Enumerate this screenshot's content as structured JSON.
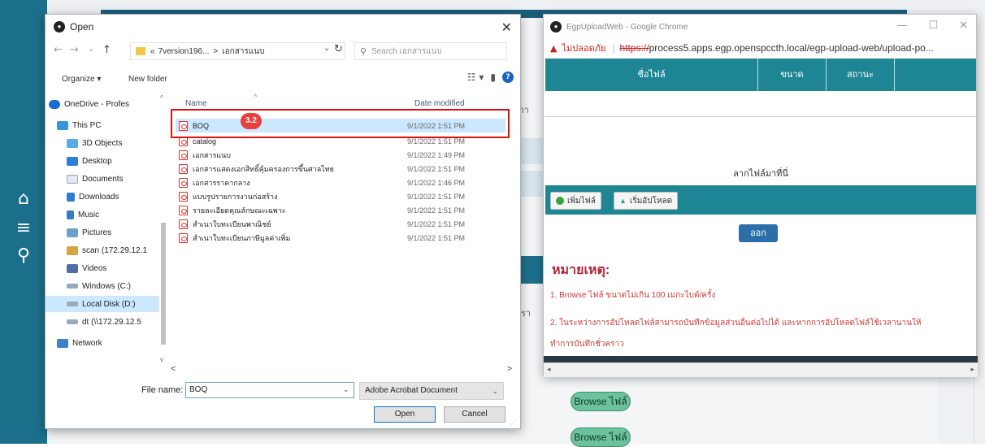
{
  "background": {
    "browse_buttons": [
      "Browse ไฟล์",
      "Browse ไฟล์"
    ],
    "partial_texts": [
      "กา",
      "ปรา"
    ]
  },
  "dialog": {
    "title": "Open",
    "address": {
      "path_part1": "7version196...",
      "separator": ">",
      "path_part2": "เอกสารแนบ"
    },
    "search_placeholder": "Search เอกสารแนบ",
    "toolbar": {
      "organize": "Organize ▾",
      "new_folder": "New folder"
    },
    "nav_items": [
      {
        "label": "OneDrive - Profes",
        "icon": "onedrive-icon"
      },
      {
        "label": "This PC",
        "icon": "pc-icon"
      },
      {
        "label": "3D Objects",
        "icon": "3d-objects-icon"
      },
      {
        "label": "Desktop",
        "icon": "desktop-icon"
      },
      {
        "label": "Documents",
        "icon": "documents-icon"
      },
      {
        "label": "Downloads",
        "icon": "downloads-icon"
      },
      {
        "label": "Music",
        "icon": "music-icon"
      },
      {
        "label": "Pictures",
        "icon": "pictures-icon"
      },
      {
        "label": "scan (172.29.12.1",
        "icon": "network-drive-icon"
      },
      {
        "label": "Videos",
        "icon": "videos-icon"
      },
      {
        "label": "Windows (C:)",
        "icon": "drive-icon"
      },
      {
        "label": "Local Disk (D:)",
        "icon": "drive-icon"
      },
      {
        "label": "dt (\\\\172.29.12.5",
        "icon": "network-drive-icon"
      },
      {
        "label": "Network",
        "icon": "network-icon"
      }
    ],
    "columns": {
      "name": "Name",
      "date": "Date modified"
    },
    "files": [
      {
        "name": "BOQ",
        "date": "9/1/2022 1:51 PM"
      },
      {
        "name": "catalog",
        "date": "9/1/2022 1:51 PM"
      },
      {
        "name": "เอกสารแนบ",
        "date": "9/1/2022 1:49 PM"
      },
      {
        "name": "เอกสารแสดงเอกสิทธิ์คุ้มครองการขึ้นศาลไทย",
        "date": "9/1/2022 1:51 PM"
      },
      {
        "name": "เอกสารราคากลาง",
        "date": "9/1/2022 1:46 PM"
      },
      {
        "name": "แบบรูปรายการงานก่อสร้าง",
        "date": "9/1/2022 1:51 PM"
      },
      {
        "name": "รายละเอียดคุณลักษณะเฉพาะ",
        "date": "9/1/2022 1:51 PM"
      },
      {
        "name": "สำเนาใบทะเบียนพาณิชย์",
        "date": "9/1/2022 1:51 PM"
      },
      {
        "name": "สำเนาใบทะเบียนภาษีมูลค่าเพิ่ม",
        "date": "9/1/2022 1:51 PM"
      }
    ],
    "step_badge": "3.2",
    "filename_label": "File name:",
    "filename_value": "BOQ",
    "file_type": "Adobe Acrobat Document",
    "open_button": "Open",
    "cancel_button": "Cancel"
  },
  "chrome": {
    "title": "EgpUploadWeb - Google Chrome",
    "not_secure": "ไม่ปลอดภัย",
    "url_scheme": "https://",
    "url_rest": "process5.apps.egp.openspccth.local/egp-upload-web/upload-po...",
    "table_headers": [
      "ชื่อไฟล์",
      "ขนาด",
      "สถานะ"
    ],
    "drop_text": "ลากไฟล์มาที่นี่",
    "add_file_button": "เพิ่มไฟล์",
    "upload_button": "เริ่มอัปโหลด",
    "exit_button": "ออก",
    "note_title": "หมายเหตุ:",
    "note_1": "1. Browse ไฟล์ ขนาดไม่เกิน 100 เมกะไบต์/ครั้ง",
    "note_2": "2. ในระหว่างการอัปโหลดไฟล์สามารถบันทึกข้อมูลส่วนอื่นต่อไปได้ และหากการอัปโหลดไฟล์ใช้เวลานานให้",
    "note_3": "ทำการบันทึกชั่วคราว"
  }
}
